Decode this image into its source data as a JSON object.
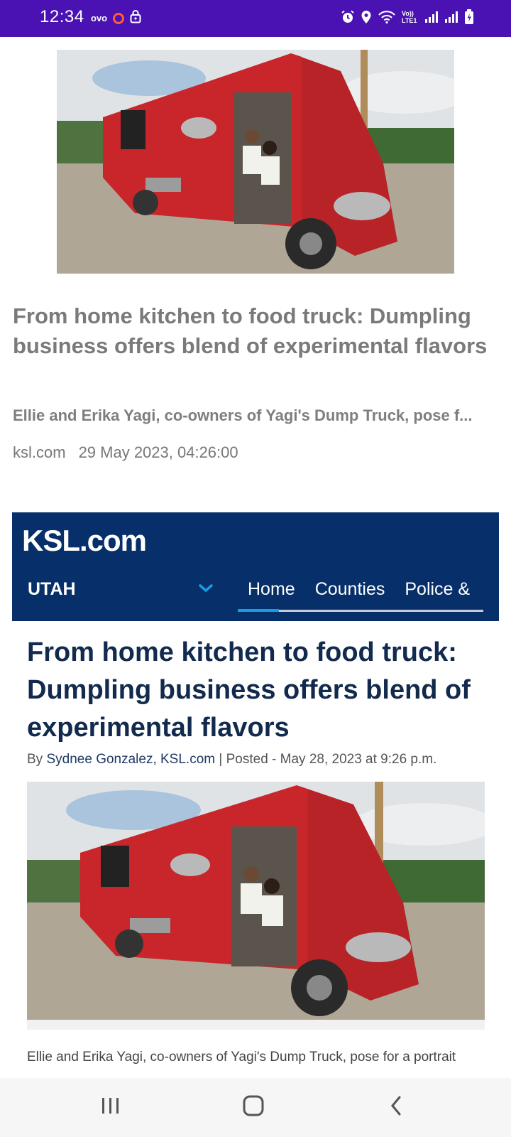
{
  "status_bar": {
    "time": "12:34",
    "carrier_label": "ovo",
    "icons": [
      "record-icon",
      "lock-icon",
      "alarm-icon",
      "location-icon",
      "wifi-icon",
      "volte-lte-icon",
      "signal-icon",
      "signal-icon",
      "battery-icon"
    ],
    "volte_text": "Vo)) LTE1"
  },
  "card1": {
    "title": "From home kitchen to food truck: Dumpling business offers blend of experimental flavors",
    "snippet": "Ellie and Erika Yagi, co-owners of Yagi's Dump Truck, pose f...",
    "source": "ksl.com",
    "date": "29 May 2023, 04:26:00"
  },
  "ksl": {
    "logo": "KSL",
    "logo_suffix": ".com",
    "section": "UTAH",
    "nav": [
      "Home",
      "Counties",
      "Police &"
    ],
    "active_nav": "Home"
  },
  "article": {
    "title": "From home kitchen to food truck: Dumpling business offers blend of experimental flavors",
    "by_prefix": "By",
    "author": "Sydnee Gonzalez, KSL.com",
    "posted": "| Posted - May 28, 2023 at 9:26 p.m.",
    "caption": "Ellie and Erika Yagi, co-owners of Yagi's Dump Truck, pose for a portrait"
  },
  "colors": {
    "status_bar": "#4a11b3",
    "ksl_navy": "#072f6a",
    "ksl_accent": "#1c9ae0",
    "truck_red": "#c8262a"
  },
  "navbar": {
    "icons": [
      "recents-icon",
      "home-icon",
      "back-icon"
    ]
  }
}
